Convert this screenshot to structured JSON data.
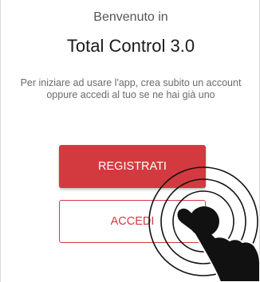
{
  "welcome": {
    "line1": "Benvenuto in",
    "app_name": "Total Control 3.0"
  },
  "intro_text": "Per iniziare ad usare l'app, crea subito un account oppure accedi al tuo se ne hai già uno",
  "buttons": {
    "register_label": "REGISTRATI",
    "login_label": "ACCEDI"
  },
  "colors": {
    "accent": "#d33a3f",
    "background": "#ffffff"
  },
  "overlay": {
    "icon": "tap-gesture-icon"
  }
}
